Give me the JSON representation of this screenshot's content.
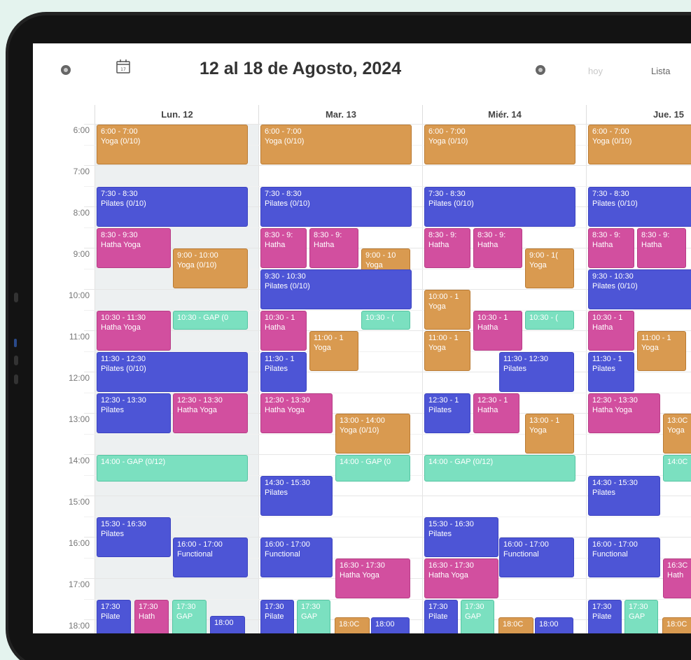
{
  "toolbar": {
    "title": "12 al 18 de Agosto, 2024",
    "calendar_day": "17",
    "hoy_label": "hoy",
    "lista_label": "Lista"
  },
  "days": [
    "Lun. 12",
    "Mar. 13",
    "Miér. 14",
    "Jue. 15"
  ],
  "hours": [
    "6:00",
    "7:00",
    "8:00",
    "9:00",
    "10:00",
    "11:00",
    "12:00",
    "13:00",
    "14:00",
    "15:00",
    "16:00",
    "17:00",
    "18:00"
  ],
  "colors": {
    "yoga": "#d99a50",
    "pilates": "#4d55d6",
    "hatha": "#d24f9f",
    "gap": "#7be0c0"
  },
  "events": [
    {
      "t": "6:00 - 7:00",
      "n": "Yoga (0/10)",
      "k": "yoga"
    },
    {
      "t": "7:30 - 8:30",
      "n": "Pilates (0/10)",
      "k": "pilates"
    },
    {
      "t": "8:30 - 9:30",
      "n": "Hatha Yoga",
      "k": "hatha"
    },
    {
      "t": "9:00 - 10:00",
      "n": "Yoga (0/10)",
      "k": "yoga"
    },
    {
      "t": "10:30 - 11:30",
      "n": "Hatha Yoga",
      "k": "hatha"
    },
    {
      "t": "10:30 - GAP (0",
      "n": "",
      "k": "gap"
    },
    {
      "t": "11:30 - 12:30",
      "n": "Pilates (0/10)",
      "k": "pilates"
    },
    {
      "t": "12:30 - 13:30",
      "n": "Pilates",
      "k": "pilates"
    },
    {
      "t": "12:30 - 13:30",
      "n": "Hatha Yoga",
      "k": "hatha"
    },
    {
      "t": "14:00 - GAP (0/12)",
      "n": "",
      "k": "gap"
    },
    {
      "t": "15:30 - 16:30",
      "n": "Pilates",
      "k": "pilates"
    },
    {
      "t": "16:00 - 17:00",
      "n": "Functional",
      "k": "functional"
    },
    {
      "t": "17:30",
      "n": "Pilate",
      "k": "pilates"
    },
    {
      "t": "17:30",
      "n": "Hath",
      "k": "hatha"
    },
    {
      "t": "17:30",
      "n": "GAP",
      "k": "gap"
    },
    {
      "t": "18:00",
      "n": "",
      "k": "pilates"
    },
    {
      "t": "6:00 - 7:00",
      "n": "Yoga (0/10)",
      "k": "yoga"
    },
    {
      "t": "7:30 - 8:30",
      "n": "Pilates (0/10)",
      "k": "pilates"
    },
    {
      "t": "8:30 - 9:",
      "n": "Hatha",
      "k": "hatha"
    },
    {
      "t": "8:30 - 9:",
      "n": "Hatha",
      "k": "hatha"
    },
    {
      "t": "9:00 - 10",
      "n": "Yoga",
      "k": "yoga"
    },
    {
      "t": "9:30 - 10:30",
      "n": "Pilates (0/10)",
      "k": "pilates"
    },
    {
      "t": "10:30 - 1",
      "n": "Hatha",
      "k": "hatha"
    },
    {
      "t": "10:30 - (",
      "n": "",
      "k": "gap"
    },
    {
      "t": "11:00 - 1",
      "n": "Yoga",
      "k": "yoga"
    },
    {
      "t": "11:30 - 1",
      "n": "Pilates",
      "k": "pilates"
    },
    {
      "t": "12:30 - 13:30",
      "n": "Hatha Yoga",
      "k": "hatha"
    },
    {
      "t": "13:00 - 14:00",
      "n": "Yoga (0/10)",
      "k": "yoga"
    },
    {
      "t": "14:00 - GAP (0",
      "n": "",
      "k": "gap"
    },
    {
      "t": "14:30 - 15:30",
      "n": "Pilates",
      "k": "pilates"
    },
    {
      "t": "16:00 - 17:00",
      "n": "Functional",
      "k": "functional"
    },
    {
      "t": "16:30 - 17:30",
      "n": "Hatha Yoga",
      "k": "hatha"
    },
    {
      "t": "17:30",
      "n": "Pilate",
      "k": "pilates"
    },
    {
      "t": "17:30",
      "n": "GAP",
      "k": "gap"
    },
    {
      "t": "18:0C",
      "n": "",
      "k": "yoga"
    },
    {
      "t": "18:00",
      "n": "",
      "k": "pilates"
    },
    {
      "t": "6:00 - 7:00",
      "n": "Yoga (0/10)",
      "k": "yoga"
    },
    {
      "t": "7:30 - 8:30",
      "n": "Pilates (0/10)",
      "k": "pilates"
    },
    {
      "t": "8:30 - 9:",
      "n": "Hatha",
      "k": "hatha"
    },
    {
      "t": "8:30 - 9:",
      "n": "Hatha",
      "k": "hatha"
    },
    {
      "t": "9:00 - 1(",
      "n": "Yoga",
      "k": "yoga"
    },
    {
      "t": "10:00 - 1",
      "n": "Yoga",
      "k": "yoga"
    },
    {
      "t": "10:30 - 1",
      "n": "Hatha",
      "k": "hatha"
    },
    {
      "t": "10:30 - (",
      "n": "",
      "k": "gap"
    },
    {
      "t": "11:00 - 1",
      "n": "Yoga",
      "k": "yoga"
    },
    {
      "t": "11:30 - 12:30",
      "n": "Pilates",
      "k": "pilates"
    },
    {
      "t": "12:30 - 1",
      "n": "Pilates",
      "k": "pilates"
    },
    {
      "t": "12:30 - 1",
      "n": "Hatha",
      "k": "hatha"
    },
    {
      "t": "13:00 - 1",
      "n": "Yoga",
      "k": "yoga"
    },
    {
      "t": "14:00 - GAP (0/12)",
      "n": "",
      "k": "gap"
    },
    {
      "t": "15:30 - 16:30",
      "n": "Pilates",
      "k": "pilates"
    },
    {
      "t": "16:00 - 17:00",
      "n": "Functional",
      "k": "functional"
    },
    {
      "t": "16:30 - 17:30",
      "n": "Hatha Yoga",
      "k": "hatha"
    },
    {
      "t": "17:30",
      "n": "Pilate",
      "k": "pilates"
    },
    {
      "t": "17:30",
      "n": "GAP",
      "k": "gap"
    },
    {
      "t": "18:0C",
      "n": "",
      "k": "yoga"
    },
    {
      "t": "18:00",
      "n": "",
      "k": "pilates"
    },
    {
      "t": "6:00 - 7:00",
      "n": "Yoga (0/10)",
      "k": "yoga"
    },
    {
      "t": "7:30 - 8:30",
      "n": "Pilates (0/10)",
      "k": "pilates"
    },
    {
      "t": "8:30 - 9:",
      "n": "Hatha",
      "k": "hatha"
    },
    {
      "t": "8:30 - 9:",
      "n": "Hatha",
      "k": "hatha"
    },
    {
      "t": "9:30 - 10:30",
      "n": "Pilates (0/10)",
      "k": "pilates"
    },
    {
      "t": "10:30 - 1",
      "n": "Hatha",
      "k": "hatha"
    },
    {
      "t": "11:00 - 1",
      "n": "Yoga",
      "k": "yoga"
    },
    {
      "t": "11:30 - 1",
      "n": "Pilates",
      "k": "pilates"
    },
    {
      "t": "12:30 - 13:30",
      "n": "Hatha Yoga",
      "k": "hatha"
    },
    {
      "t": "13:0C",
      "n": "Yoga",
      "k": "yoga"
    },
    {
      "t": "14:0C",
      "n": "",
      "k": "gap"
    },
    {
      "t": "14:30 - 15:30",
      "n": "Pilates",
      "k": "pilates"
    },
    {
      "t": "16:00 - 17:00",
      "n": "Functional",
      "k": "functional"
    },
    {
      "t": "16:3C",
      "n": "Hath",
      "k": "hatha"
    },
    {
      "t": "17:30",
      "n": "Pilate",
      "k": "pilates"
    },
    {
      "t": "17:30",
      "n": "GAP",
      "k": "gap"
    },
    {
      "t": "18:0C",
      "n": "",
      "k": "yoga"
    }
  ]
}
